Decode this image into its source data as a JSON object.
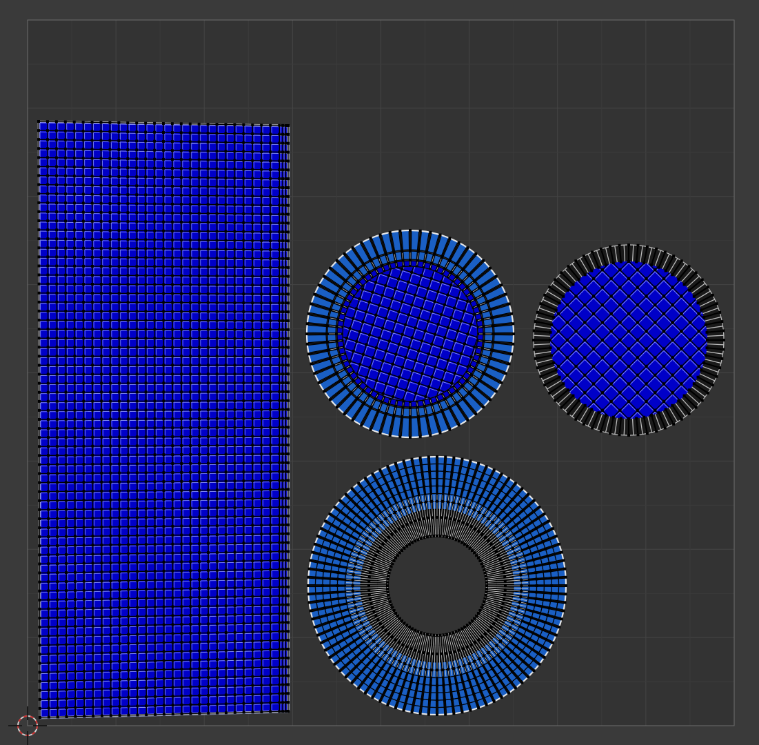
{
  "editor": {
    "type": "uv-editor-viewport",
    "background_color": "#3a3a3a",
    "uv_bounds_fill": "#333333",
    "grid_color": "#454545",
    "border_color": "#6e6e6e",
    "face_fill_dense": "#0000c8",
    "face_fill_light": "#1a5fc4",
    "edge_color": "#000000",
    "vertex_color": "#000000",
    "seam_color": "#e6e6e6"
  },
  "islands": [
    {
      "name": "rectangle-island",
      "shape": "grid",
      "columns": 28,
      "rows": 66
    },
    {
      "name": "sphere-island",
      "shape": "disc-with-ring",
      "segments": 64,
      "fill": "#0000c8",
      "ring_fill": "#1a5fc4"
    },
    {
      "name": "cap-island",
      "shape": "disc-with-dense-rim",
      "segments": 64,
      "fill": "#0000c8"
    },
    {
      "name": "tube-island",
      "shape": "annulus",
      "segments": 96,
      "rings": 10,
      "fill": "#1a5fc4"
    }
  ],
  "cursor": {
    "name": "2d-cursor",
    "color_a": "#d0d0d0",
    "color_b": "#d03030"
  }
}
